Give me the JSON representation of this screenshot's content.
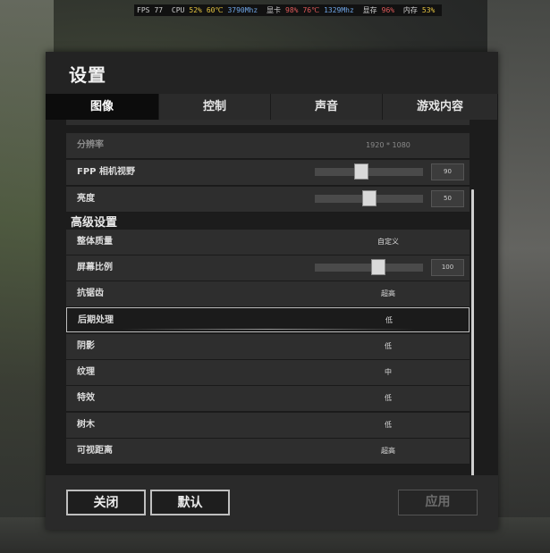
{
  "overlay": {
    "fps_label": "FPS",
    "fps": "77",
    "cpu_label": "CPU",
    "cpu_usage": "52%",
    "cpu_temp": "60℃",
    "cpu_clock": "3790Mhz",
    "gpu_label": "显卡",
    "gpu_usage": "98%",
    "gpu_temp": "76℃",
    "gpu_clock": "1329Mhz",
    "vram_label": "显存",
    "vram_usage": "96%",
    "mem_label": "内存",
    "mem_usage": "53%"
  },
  "window": {
    "title": "设置"
  },
  "tabs": [
    {
      "label": "图像",
      "active": true
    },
    {
      "label": "控制",
      "active": false
    },
    {
      "label": "声音",
      "active": false
    },
    {
      "label": "游戏内容",
      "active": false
    }
  ],
  "settings": {
    "resolution": {
      "label": "分辨率",
      "value": "1920 * 1080"
    },
    "fpp_fov": {
      "label": "FPP 相机视野",
      "value": "90",
      "slider_level": 0.42
    },
    "brightness": {
      "label": "亮度",
      "value": "50",
      "slider_level": 0.5
    }
  },
  "advanced": {
    "heading": "高级设置",
    "overall_quality": {
      "label": "整体质量",
      "value": "自定义"
    },
    "screen_scale": {
      "label": "屏幕比例",
      "value": "100",
      "slider_level": 0.6
    },
    "anti_aliasing": {
      "label": "抗锯齿",
      "value": "超高"
    },
    "post_processing": {
      "label": "后期处理",
      "value": "低"
    },
    "shadows": {
      "label": "阴影",
      "value": "低"
    },
    "textures": {
      "label": "纹理",
      "value": "中"
    },
    "effects": {
      "label": "特效",
      "value": "低"
    },
    "foliage": {
      "label": "树木",
      "value": "低"
    },
    "view_distance": {
      "label": "可视距离",
      "value": "超高"
    }
  },
  "footer": {
    "close_label": "关闭",
    "default_label": "默认",
    "apply_label": "应用"
  },
  "colors": {
    "overlay_yellow": "#e5c440",
    "overlay_blue": "#6fa6e8",
    "overlay_red": "#e05a5a",
    "panel_bg": "#1e1e1e",
    "active_tab": "#0c0c0c"
  }
}
